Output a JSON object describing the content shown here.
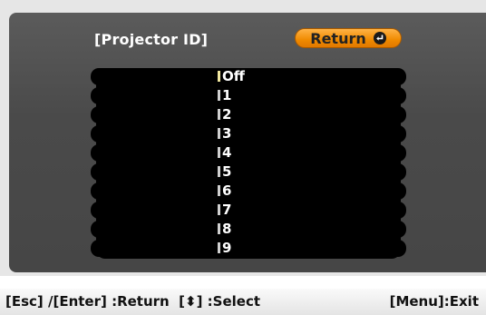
{
  "menu": {
    "title": "[Projector ID]",
    "return_label": "Return",
    "return_icon": "enter-icon"
  },
  "options": [
    {
      "label": "Off",
      "selected": true
    },
    {
      "label": "1"
    },
    {
      "label": "2"
    },
    {
      "label": "3"
    },
    {
      "label": "4"
    },
    {
      "label": "5"
    },
    {
      "label": "6"
    },
    {
      "label": "7"
    },
    {
      "label": "8"
    },
    {
      "label": "9"
    }
  ],
  "help_bar": {
    "left_text": "[Esc] /[Enter] :Return  [⬍] :Select",
    "right_text": "[Menu]:Exit"
  },
  "colors": {
    "accent": "#f08a00",
    "panel": "#4a4a4a",
    "list_bg": "#000000"
  }
}
